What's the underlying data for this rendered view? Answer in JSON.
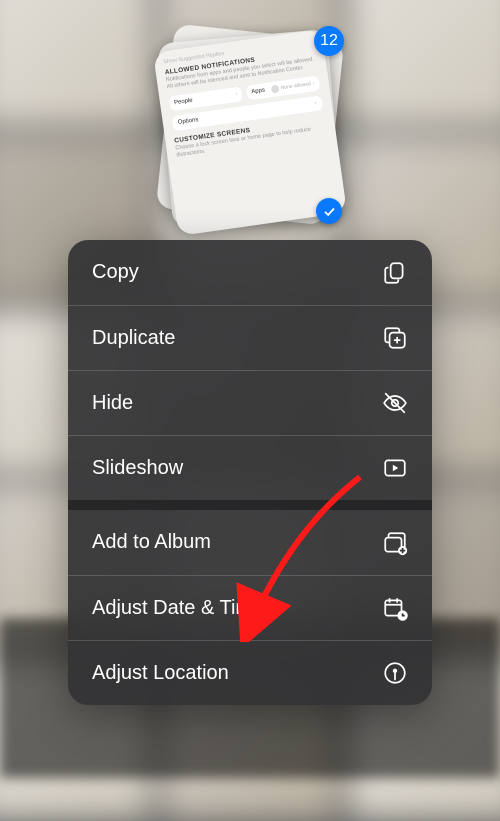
{
  "selection": {
    "count": "12",
    "checked": true
  },
  "preview_card": {
    "faded_header": "Show Suggested Replies",
    "section1_title": "ALLOWED NOTIFICATIONS",
    "section1_desc": "Notifications from apps and people you select will be allowed. All others will be silenced and sent to Notification Center.",
    "people_label": "People",
    "apps_label": "Apps",
    "none_label": "None allowed",
    "options_label": "Options",
    "section2_title": "CUSTOMIZE SCREENS",
    "section2_desc": "Choose a lock screen face or home page to help reduce distractions."
  },
  "menu": {
    "copy": "Copy",
    "duplicate": "Duplicate",
    "hide": "Hide",
    "slideshow": "Slideshow",
    "add_to_album": "Add to Album",
    "adjust_date_time": "Adjust Date & Time",
    "adjust_location": "Adjust Location"
  },
  "annotation": {
    "arrow_target": "adjust-date-time"
  }
}
